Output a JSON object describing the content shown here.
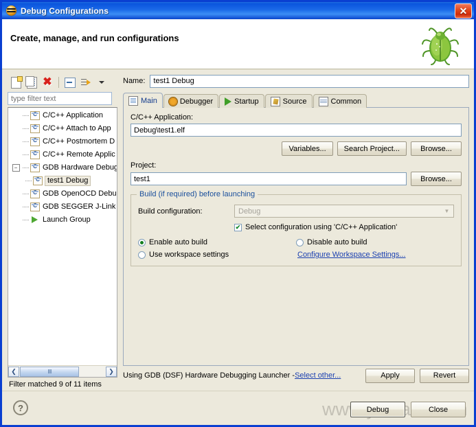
{
  "window": {
    "title": "Debug Configurations",
    "icon": "eclipse-icon",
    "close_label": "✕"
  },
  "header": {
    "title": "Create, manage, and run configurations",
    "image": "green-bug-icon"
  },
  "sidebar": {
    "toolbar": [
      {
        "name": "new-launch-configuration-icon",
        "label": ""
      },
      {
        "name": "duplicate-launch-configuration-icon",
        "label": ""
      },
      {
        "name": "delete-launch-configuration-icon",
        "label": "✖"
      },
      {
        "name": "collapse-all-icon",
        "label": ""
      },
      {
        "name": "filter-launch-configurations-icon",
        "label": ""
      },
      {
        "name": "view-menu-caret-icon",
        "label": ""
      }
    ],
    "filter": {
      "value": "",
      "placeholder": "type filter text"
    },
    "tree": [
      {
        "label": "C/C++ Application",
        "icon": "c-config-icon",
        "indent": 1,
        "expander": "",
        "selected": false
      },
      {
        "label": "C/C++ Attach to App",
        "icon": "c-config-icon",
        "indent": 1,
        "expander": "",
        "selected": false
      },
      {
        "label": "C/C++ Postmortem D",
        "icon": "c-config-icon",
        "indent": 1,
        "expander": "",
        "selected": false
      },
      {
        "label": "C/C++ Remote Applic",
        "icon": "c-config-icon",
        "indent": 1,
        "expander": "",
        "selected": false
      },
      {
        "label": "GDB Hardware Debug",
        "icon": "c-config-icon",
        "indent": 1,
        "expander": "−",
        "selected": false
      },
      {
        "label": "test1 Debug",
        "icon": "c-config-icon",
        "indent": 2,
        "expander": "",
        "selected": true
      },
      {
        "label": "GDB OpenOCD Debug",
        "icon": "c-config-icon",
        "indent": 1,
        "expander": "",
        "selected": false
      },
      {
        "label": "GDB SEGGER J-Link D",
        "icon": "c-config-icon",
        "indent": 1,
        "expander": "",
        "selected": false
      },
      {
        "label": "Launch Group",
        "icon": "launch-group-icon",
        "indent": 1,
        "expander": "",
        "selected": false
      }
    ],
    "scroll": {
      "left_arrow": "❮",
      "right_arrow": "❯",
      "grip": "IIII"
    },
    "status": "Filter matched 9 of 11 items"
  },
  "main": {
    "name_label": "Name:",
    "name_value": "test1 Debug",
    "tabs": [
      {
        "label": "Main",
        "icon": "main-tab-icon",
        "active": true
      },
      {
        "label": "Debugger",
        "icon": "debugger-tab-icon",
        "active": false
      },
      {
        "label": "Startup",
        "icon": "startup-tab-icon",
        "active": false
      },
      {
        "label": "Source",
        "icon": "source-tab-icon",
        "active": false
      },
      {
        "label": "Common",
        "icon": "common-tab-icon",
        "active": false
      }
    ],
    "application": {
      "label": "C/C++ Application:",
      "value": "Debug\\test1.elf",
      "buttons": [
        "Variables...",
        "Search Project...",
        "Browse..."
      ]
    },
    "project": {
      "label": "Project:",
      "value": "test1",
      "browse_label": "Browse..."
    },
    "build_group": {
      "legend": "Build (if required) before launching",
      "config_label": "Build configuration:",
      "config_value": "Debug",
      "config_arrow": "▼",
      "checkbox": {
        "label": "Select configuration using 'C/C++ Application'",
        "checked": true,
        "mark": "✔"
      },
      "radios": [
        {
          "label": "Enable auto build",
          "selected": true
        },
        {
          "label": "Disable auto build",
          "selected": false
        },
        {
          "label": "Use workspace settings",
          "selected": false
        }
      ],
      "link": "Configure Workspace Settings..."
    },
    "footer": {
      "text": "Using GDB (DSF) Hardware Debugging Launcher - ",
      "link": "Select other...",
      "apply_label": "Apply",
      "revert_label": "Revert"
    }
  },
  "dialog": {
    "help_label": "?",
    "debug_label": "Debug",
    "close_label": "Close"
  },
  "watermark": "www.ylboard.com"
}
